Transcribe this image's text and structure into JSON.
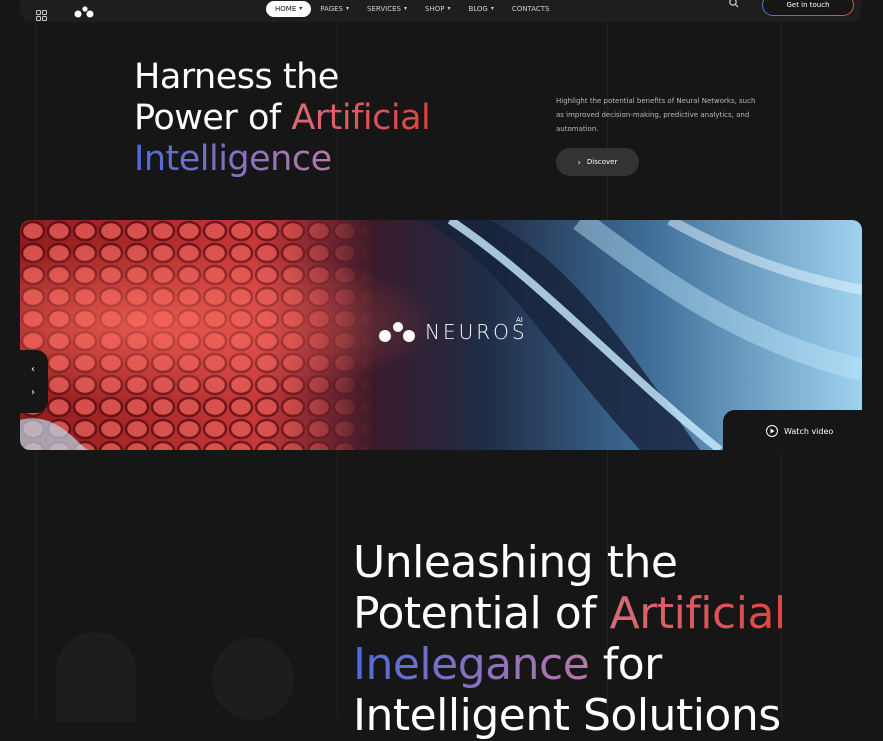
{
  "header": {
    "nav": [
      {
        "label": "HOME",
        "active": true,
        "caret": true
      },
      {
        "label": "PAGES",
        "caret": true
      },
      {
        "label": "SERVICES",
        "caret": true
      },
      {
        "label": "SHOP",
        "caret": true
      },
      {
        "label": "BLOG",
        "caret": true
      },
      {
        "label": "CONTACTS",
        "caret": false
      }
    ],
    "cta_label": "Get in touch",
    "icons": {
      "menu": "grid-icon",
      "logo": "neuros-logo-icon",
      "search": "search-icon"
    }
  },
  "hero": {
    "title_line1": "Harness the",
    "title_line2_plain": "Power of ",
    "title_line2_accent": "Artificial",
    "title_line3_accent": "Intelligence",
    "description": "Highlight the potential benefits of Neural Networks, such as improved decision-making, predictive analytics, and automation.",
    "discover_label": "Discover"
  },
  "banner": {
    "logo_text": "NEUROS",
    "logo_superscript": "AI",
    "watch_label": "Watch video"
  },
  "section2": {
    "line1": "Unleashing the",
    "line2_plain": "Potential of ",
    "line2_accent": "Artificial",
    "line3_accent": "Inelegance",
    "line3_plain": " for",
    "line4": "Intelligent Solutions"
  },
  "colors": {
    "background": "#161616",
    "accent_red": "#e2423f",
    "accent_blue": "#4e6cd8",
    "button": "#333333"
  }
}
